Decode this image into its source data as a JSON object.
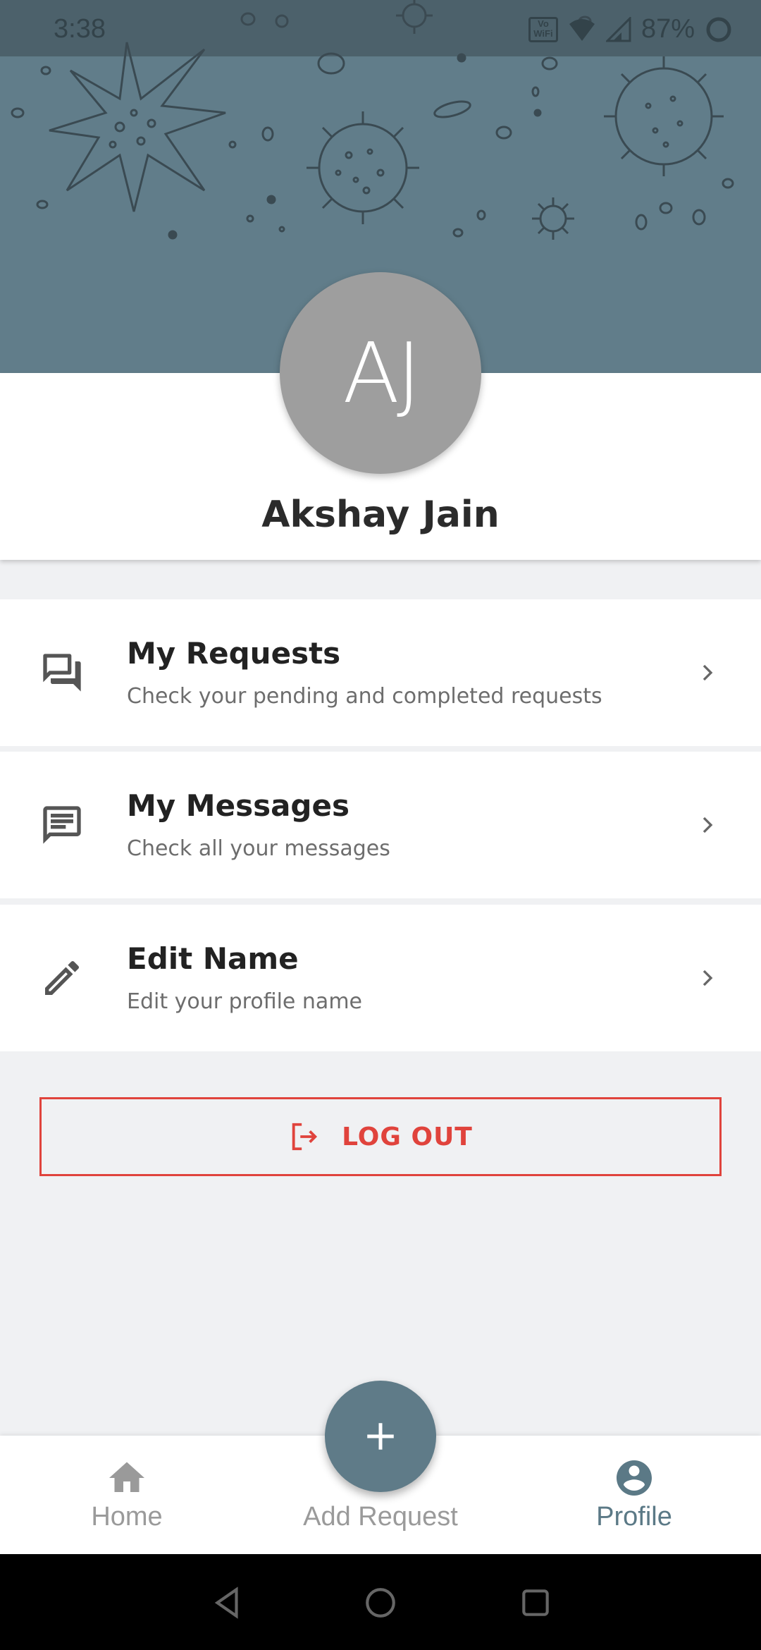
{
  "status_bar": {
    "time": "3:38",
    "network_badge": "Vo WiFi",
    "battery": "87%"
  },
  "profile": {
    "initials": "AJ",
    "name": "Akshay Jain"
  },
  "menu": [
    {
      "title": "My Requests",
      "subtitle": "Check your pending and completed requests",
      "icon": "forum-icon"
    },
    {
      "title": "My Messages",
      "subtitle": "Check all your messages",
      "icon": "message-icon"
    },
    {
      "title": "Edit Name",
      "subtitle": "Edit your profile name",
      "icon": "pencil-icon"
    }
  ],
  "logout": {
    "label": "LOG OUT"
  },
  "bottom_nav": {
    "items": [
      {
        "label": "Home",
        "icon": "home-icon",
        "active": false
      },
      {
        "label": "Add Request",
        "icon": "plus-icon",
        "active": false
      },
      {
        "label": "Profile",
        "icon": "account-circle-icon",
        "active": true
      }
    ]
  },
  "colors": {
    "header": "#617d8a",
    "accent": "#5b7986",
    "danger": "#e0433c",
    "background": "#f0f1f3"
  }
}
